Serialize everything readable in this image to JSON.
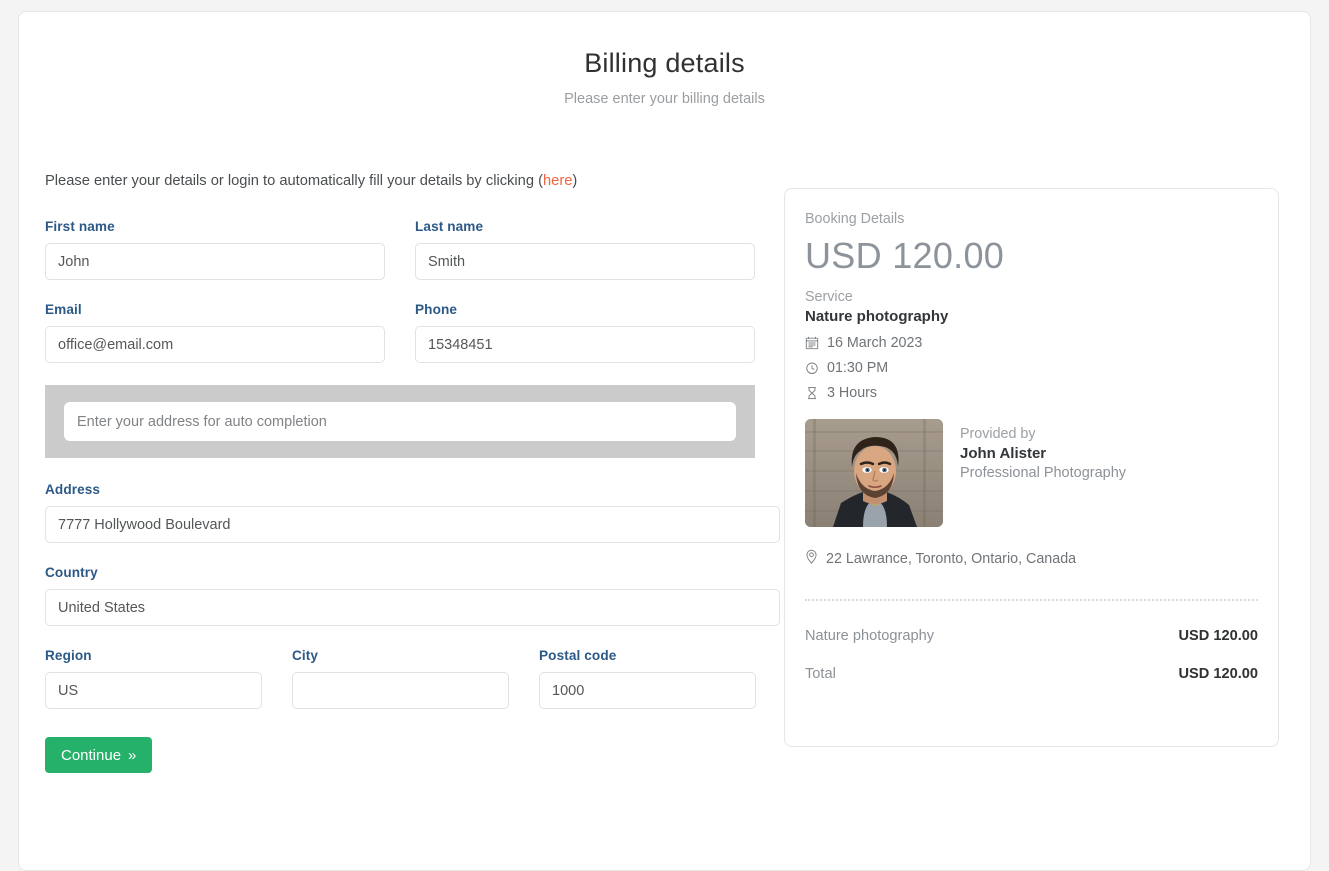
{
  "header": {
    "title": "Billing details",
    "subtitle": "Please enter your billing details"
  },
  "form": {
    "intro_prefix": "Please enter your details or login to automatically fill your details by clicking (",
    "intro_link": "here",
    "intro_suffix": ")",
    "fields": {
      "first_name": {
        "label": "First name",
        "value": "John",
        "placeholder": "First name"
      },
      "last_name": {
        "label": "Last name",
        "value": "Smith",
        "placeholder": "Last name"
      },
      "email": {
        "label": "Email",
        "value": "office@email.com",
        "placeholder": "Email"
      },
      "phone": {
        "label": "Phone",
        "value": "15348451",
        "placeholder": "Phone"
      },
      "autocomplete": {
        "label": "",
        "value": "",
        "placeholder": "Enter your address for auto completion"
      },
      "address": {
        "label": "Address",
        "value": "7777 Hollywood Boulevard",
        "placeholder": "Address"
      },
      "country": {
        "label": "Country",
        "value": "United States",
        "placeholder": "Country"
      },
      "region": {
        "label": "Region",
        "value": "US",
        "placeholder": "Region"
      },
      "city": {
        "label": "City",
        "value": "",
        "placeholder": ""
      },
      "postal_code": {
        "label": "Postal code",
        "value": "1000",
        "placeholder": "Postal code"
      }
    },
    "submit_label": "Continue",
    "submit_chevron": "»"
  },
  "summary": {
    "heading": "Booking Details",
    "price": "USD 120.00",
    "service_label": "Service",
    "service_name": "Nature photography",
    "date": "16 March 2023",
    "time": "01:30 PM",
    "duration": "3 Hours",
    "provided_by_label": "Provided by",
    "provider_name": "John Alister",
    "provider_business": "Professional Photography",
    "location": "22 Lawrance, Toronto, Ontario, Canada",
    "line_items": [
      {
        "name": "Nature photography",
        "amount": "USD 120.00"
      },
      {
        "name": "Total",
        "amount": "USD 120.00"
      }
    ]
  },
  "colors": {
    "accent_green": "#25b16a",
    "label_blue": "#2d5986",
    "link_orange": "#f06543",
    "page_bg": "#f4f4f4",
    "autocomplete_bg": "#cbcbcb"
  }
}
